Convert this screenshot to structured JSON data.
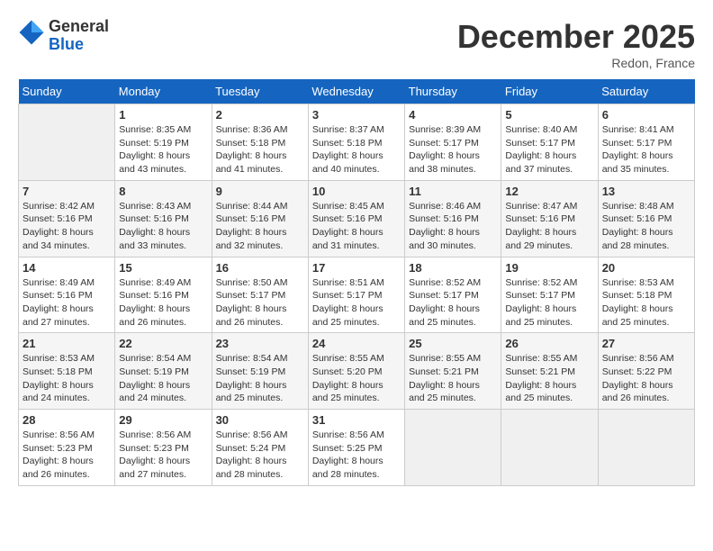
{
  "header": {
    "logo_general": "General",
    "logo_blue": "Blue",
    "month": "December 2025",
    "location": "Redon, France"
  },
  "columns": [
    "Sunday",
    "Monday",
    "Tuesday",
    "Wednesday",
    "Thursday",
    "Friday",
    "Saturday"
  ],
  "weeks": [
    [
      {
        "day": "",
        "info": ""
      },
      {
        "day": "1",
        "info": "Sunrise: 8:35 AM\nSunset: 5:19 PM\nDaylight: 8 hours\nand 43 minutes."
      },
      {
        "day": "2",
        "info": "Sunrise: 8:36 AM\nSunset: 5:18 PM\nDaylight: 8 hours\nand 41 minutes."
      },
      {
        "day": "3",
        "info": "Sunrise: 8:37 AM\nSunset: 5:18 PM\nDaylight: 8 hours\nand 40 minutes."
      },
      {
        "day": "4",
        "info": "Sunrise: 8:39 AM\nSunset: 5:17 PM\nDaylight: 8 hours\nand 38 minutes."
      },
      {
        "day": "5",
        "info": "Sunrise: 8:40 AM\nSunset: 5:17 PM\nDaylight: 8 hours\nand 37 minutes."
      },
      {
        "day": "6",
        "info": "Sunrise: 8:41 AM\nSunset: 5:17 PM\nDaylight: 8 hours\nand 35 minutes."
      }
    ],
    [
      {
        "day": "7",
        "info": "Sunrise: 8:42 AM\nSunset: 5:16 PM\nDaylight: 8 hours\nand 34 minutes."
      },
      {
        "day": "8",
        "info": "Sunrise: 8:43 AM\nSunset: 5:16 PM\nDaylight: 8 hours\nand 33 minutes."
      },
      {
        "day": "9",
        "info": "Sunrise: 8:44 AM\nSunset: 5:16 PM\nDaylight: 8 hours\nand 32 minutes."
      },
      {
        "day": "10",
        "info": "Sunrise: 8:45 AM\nSunset: 5:16 PM\nDaylight: 8 hours\nand 31 minutes."
      },
      {
        "day": "11",
        "info": "Sunrise: 8:46 AM\nSunset: 5:16 PM\nDaylight: 8 hours\nand 30 minutes."
      },
      {
        "day": "12",
        "info": "Sunrise: 8:47 AM\nSunset: 5:16 PM\nDaylight: 8 hours\nand 29 minutes."
      },
      {
        "day": "13",
        "info": "Sunrise: 8:48 AM\nSunset: 5:16 PM\nDaylight: 8 hours\nand 28 minutes."
      }
    ],
    [
      {
        "day": "14",
        "info": "Sunrise: 8:49 AM\nSunset: 5:16 PM\nDaylight: 8 hours\nand 27 minutes."
      },
      {
        "day": "15",
        "info": "Sunrise: 8:49 AM\nSunset: 5:16 PM\nDaylight: 8 hours\nand 26 minutes."
      },
      {
        "day": "16",
        "info": "Sunrise: 8:50 AM\nSunset: 5:17 PM\nDaylight: 8 hours\nand 26 minutes."
      },
      {
        "day": "17",
        "info": "Sunrise: 8:51 AM\nSunset: 5:17 PM\nDaylight: 8 hours\nand 25 minutes."
      },
      {
        "day": "18",
        "info": "Sunrise: 8:52 AM\nSunset: 5:17 PM\nDaylight: 8 hours\nand 25 minutes."
      },
      {
        "day": "19",
        "info": "Sunrise: 8:52 AM\nSunset: 5:17 PM\nDaylight: 8 hours\nand 25 minutes."
      },
      {
        "day": "20",
        "info": "Sunrise: 8:53 AM\nSunset: 5:18 PM\nDaylight: 8 hours\nand 25 minutes."
      }
    ],
    [
      {
        "day": "21",
        "info": "Sunrise: 8:53 AM\nSunset: 5:18 PM\nDaylight: 8 hours\nand 24 minutes."
      },
      {
        "day": "22",
        "info": "Sunrise: 8:54 AM\nSunset: 5:19 PM\nDaylight: 8 hours\nand 24 minutes."
      },
      {
        "day": "23",
        "info": "Sunrise: 8:54 AM\nSunset: 5:19 PM\nDaylight: 8 hours\nand 25 minutes."
      },
      {
        "day": "24",
        "info": "Sunrise: 8:55 AM\nSunset: 5:20 PM\nDaylight: 8 hours\nand 25 minutes."
      },
      {
        "day": "25",
        "info": "Sunrise: 8:55 AM\nSunset: 5:21 PM\nDaylight: 8 hours\nand 25 minutes."
      },
      {
        "day": "26",
        "info": "Sunrise: 8:55 AM\nSunset: 5:21 PM\nDaylight: 8 hours\nand 25 minutes."
      },
      {
        "day": "27",
        "info": "Sunrise: 8:56 AM\nSunset: 5:22 PM\nDaylight: 8 hours\nand 26 minutes."
      }
    ],
    [
      {
        "day": "28",
        "info": "Sunrise: 8:56 AM\nSunset: 5:23 PM\nDaylight: 8 hours\nand 26 minutes."
      },
      {
        "day": "29",
        "info": "Sunrise: 8:56 AM\nSunset: 5:23 PM\nDaylight: 8 hours\nand 27 minutes."
      },
      {
        "day": "30",
        "info": "Sunrise: 8:56 AM\nSunset: 5:24 PM\nDaylight: 8 hours\nand 28 minutes."
      },
      {
        "day": "31",
        "info": "Sunrise: 8:56 AM\nSunset: 5:25 PM\nDaylight: 8 hours\nand 28 minutes."
      },
      {
        "day": "",
        "info": ""
      },
      {
        "day": "",
        "info": ""
      },
      {
        "day": "",
        "info": ""
      }
    ]
  ]
}
